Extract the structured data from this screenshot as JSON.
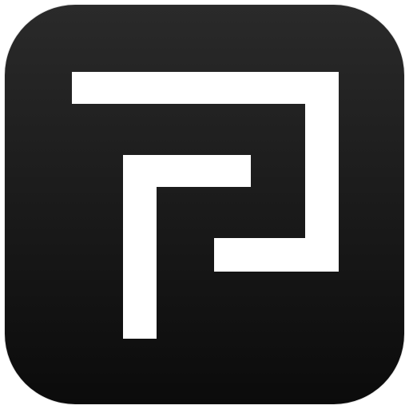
{
  "icon": {
    "name": "app-icon",
    "glyph": "interlocking-bracket-mark",
    "colors": {
      "background_top": "#2a2a2a",
      "background_bottom": "#0b0b0b",
      "mark": "#ffffff",
      "page": "#ffffff"
    }
  }
}
